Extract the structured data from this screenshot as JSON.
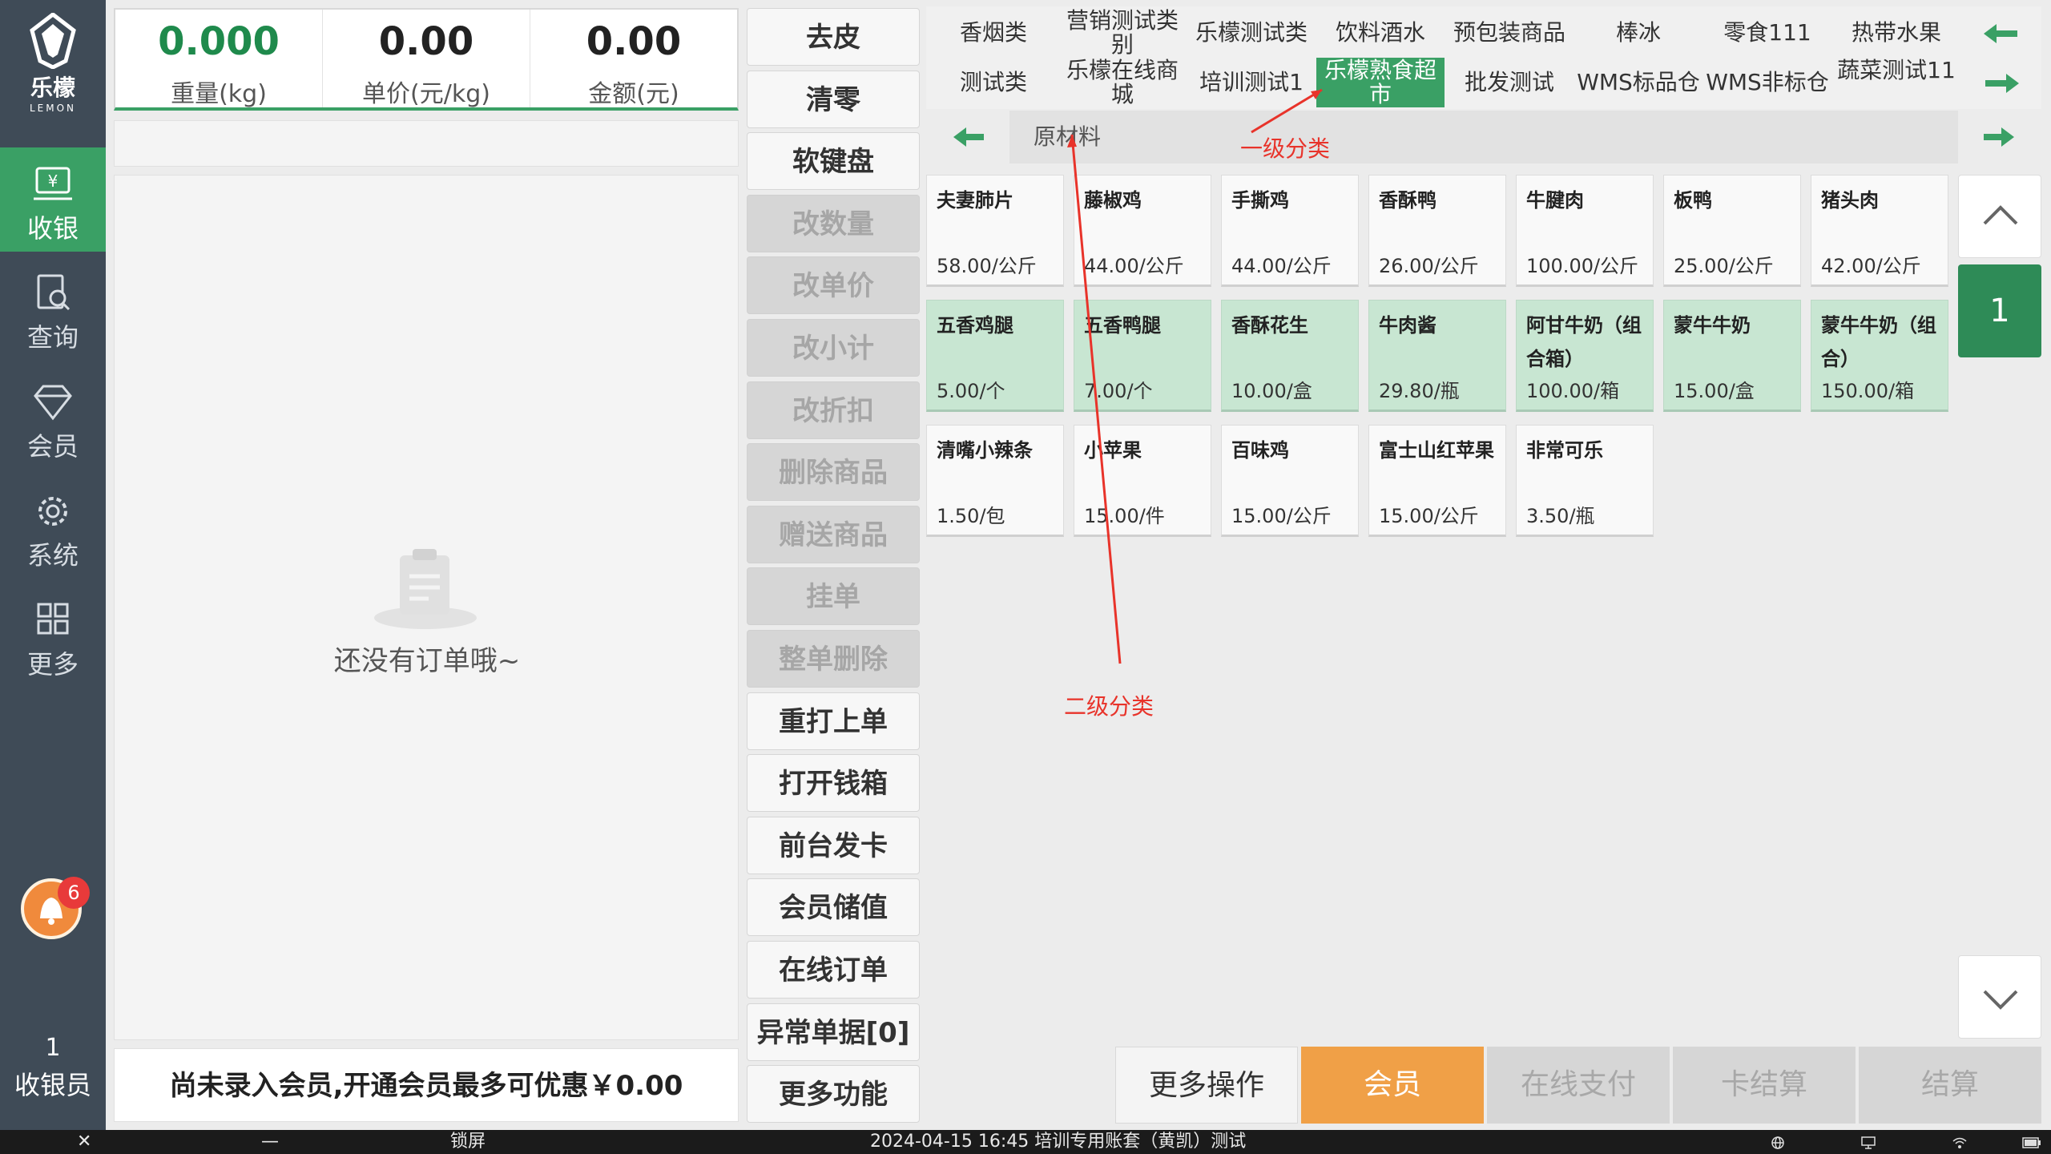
{
  "sidebar": {
    "logo": {
      "name": "乐檬",
      "en": "LEMON"
    },
    "nav": [
      {
        "label": "收银",
        "icon": "cashier-icon"
      },
      {
        "label": "查询",
        "icon": "search-doc-icon"
      },
      {
        "label": "会员",
        "icon": "diamond-icon"
      },
      {
        "label": "系统",
        "icon": "gear-icon"
      },
      {
        "label": "更多",
        "icon": "grid-icon"
      }
    ],
    "notify_count": "6",
    "cashier": {
      "number": "1",
      "label": "收银员"
    }
  },
  "scale": {
    "weight_value": "0.000",
    "weight_label": "重量(kg)",
    "price_value": "0.00",
    "price_label": "单价(元/kg)",
    "amount_value": "0.00",
    "amount_label": "金额(元)"
  },
  "order": {
    "empty_text": "还没有订单哦~"
  },
  "member_tip": "尚未录入会员,开通会员最多可优惠￥0.00",
  "functions": [
    {
      "label": "去皮",
      "enabled": true
    },
    {
      "label": "清零",
      "enabled": true
    },
    {
      "label": "软键盘",
      "enabled": true
    },
    {
      "label": "改数量",
      "enabled": false
    },
    {
      "label": "改单价",
      "enabled": false
    },
    {
      "label": "改小计",
      "enabled": false
    },
    {
      "label": "改折扣",
      "enabled": false
    },
    {
      "label": "删除商品",
      "enabled": false
    },
    {
      "label": "赠送商品",
      "enabled": false
    },
    {
      "label": "挂单",
      "enabled": false
    },
    {
      "label": "整单删除",
      "enabled": false
    },
    {
      "label": "重打上单",
      "enabled": true
    },
    {
      "label": "打开钱箱",
      "enabled": true
    },
    {
      "label": "前台发卡",
      "enabled": true
    },
    {
      "label": "会员储值",
      "enabled": true
    },
    {
      "label": "在线订单",
      "enabled": true
    },
    {
      "label": "异常单据[0]",
      "enabled": true
    },
    {
      "label": "更多功能",
      "enabled": true
    }
  ],
  "categories": {
    "row1": [
      "香烟类",
      "营销测试类别",
      "乐檬测试类",
      "饮料酒水",
      "预包装商品",
      "棒冰",
      "零食111",
      "热带水果"
    ],
    "row2": [
      "测试类",
      "乐檬在线商城",
      "培训测试1",
      "乐檬熟食超市",
      "批发测试",
      "WMS标品仓",
      "WMS非标仓",
      "蔬菜测试11"
    ],
    "active": "乐檬熟食超市",
    "subcategory": "原材料"
  },
  "products": [
    {
      "name": "夫妻肺片",
      "price": "58.00/公斤",
      "green": false
    },
    {
      "name": "藤椒鸡",
      "price": "44.00/公斤",
      "green": false
    },
    {
      "name": "手撕鸡",
      "price": "44.00/公斤",
      "green": false
    },
    {
      "name": "香酥鸭",
      "price": "26.00/公斤",
      "green": false
    },
    {
      "name": "牛腱肉",
      "price": "100.00/公斤",
      "green": false
    },
    {
      "name": "板鸭",
      "price": "25.00/公斤",
      "green": false
    },
    {
      "name": "猪头肉",
      "price": "42.00/公斤",
      "green": false
    },
    {
      "name": "五香鸡腿",
      "price": "5.00/个",
      "green": true
    },
    {
      "name": "五香鸭腿",
      "price": "7.00/个",
      "green": true
    },
    {
      "name": "香酥花生",
      "price": "10.00/盒",
      "green": true
    },
    {
      "name": "牛肉酱",
      "price": "29.80/瓶",
      "green": true
    },
    {
      "name": "阿甘牛奶（组合箱）",
      "price": "100.00/箱",
      "green": true
    },
    {
      "name": "蒙牛牛奶",
      "price": "15.00/盒",
      "green": true
    },
    {
      "name": "蒙牛牛奶（组合）",
      "price": "150.00/箱",
      "green": true
    },
    {
      "name": "清嘴小辣条",
      "price": "1.50/包",
      "green": false
    },
    {
      "name": "小苹果",
      "price": "15.00/件",
      "green": false
    },
    {
      "name": "百味鸡",
      "price": "15.00/公斤",
      "green": false
    },
    {
      "name": "富士山红苹果",
      "price": "15.00/公斤",
      "green": false
    },
    {
      "name": "非常可乐",
      "price": "3.50/瓶",
      "green": false
    }
  ],
  "pagination": {
    "page": "1"
  },
  "actions": {
    "more": "更多操作",
    "member": "会员",
    "online_pay": "在线支付",
    "card_pay": "卡结算",
    "checkout": "结算"
  },
  "annotations": {
    "first_level": "一级分类",
    "second_level": "二级分类"
  },
  "statusbar": {
    "close": "✕",
    "minimize": "—",
    "lock": "锁屏",
    "info": "2024-04-15 16:45 培训专用账套（黄凯）测试"
  },
  "colors": {
    "accent_green": "#3aa065",
    "member_orange": "#f0a047",
    "annotation_red": "#e8332a"
  }
}
